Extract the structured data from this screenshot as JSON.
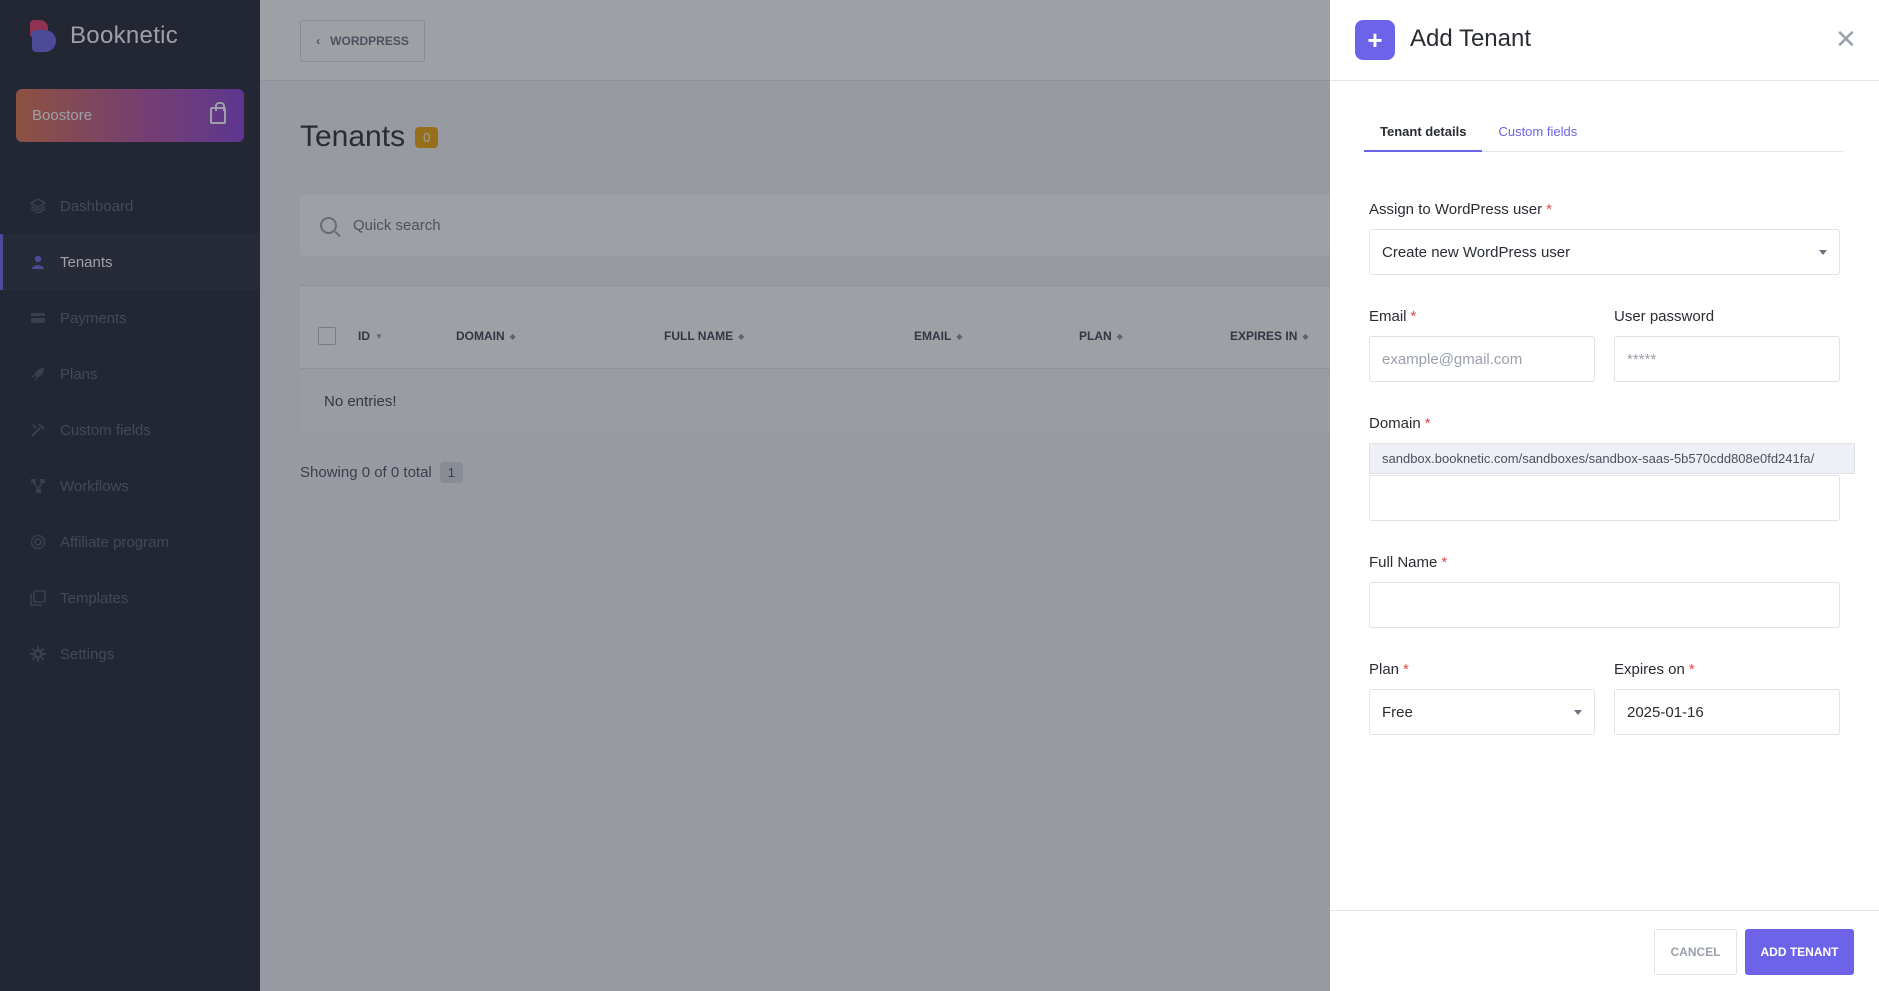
{
  "app": {
    "name": "Booknetic"
  },
  "boostore": {
    "label": "Boostore"
  },
  "sidebar": {
    "items": [
      {
        "label": "Dashboard",
        "icon": "dashboard-icon"
      },
      {
        "label": "Tenants",
        "icon": "user-icon",
        "active": true
      },
      {
        "label": "Payments",
        "icon": "card-icon"
      },
      {
        "label": "Plans",
        "icon": "rocket-icon"
      },
      {
        "label": "Custom fields",
        "icon": "tools-icon"
      },
      {
        "label": "Workflows",
        "icon": "workflow-icon"
      },
      {
        "label": "Affiliate program",
        "icon": "target-icon"
      },
      {
        "label": "Templates",
        "icon": "templates-icon"
      },
      {
        "label": "Settings",
        "icon": "gear-icon"
      }
    ]
  },
  "topbar": {
    "back_label": "WORDPRESS"
  },
  "page": {
    "title": "Tenants",
    "count": "0",
    "search_placeholder": "Quick search",
    "columns": [
      "ID",
      "DOMAIN",
      "FULL NAME",
      "EMAIL",
      "PLAN",
      "EXPIRES IN"
    ],
    "empty_text": "No entries!",
    "showing_text": "Showing 0 of 0 total",
    "page_number": "1"
  },
  "drawer": {
    "title": "Add Tenant",
    "tabs": [
      "Tenant details",
      "Custom fields"
    ],
    "fields": {
      "wp_user": {
        "label": "Assign to WordPress user",
        "value": "Create new WordPress user"
      },
      "email": {
        "label": "Email",
        "placeholder": "example@gmail.com"
      },
      "password": {
        "label": "User password",
        "placeholder": "*****"
      },
      "domain": {
        "label": "Domain",
        "prefix": "sandbox.booknetic.com/sandboxes/sandbox-saas-5b570cdd808e0fd241fa/",
        "value": ""
      },
      "full_name": {
        "label": "Full Name",
        "value": ""
      },
      "plan": {
        "label": "Plan",
        "value": "Free"
      },
      "expires": {
        "label": "Expires on",
        "value": "2025-01-16"
      }
    },
    "cancel_label": "CANCEL",
    "submit_label": "ADD TENANT"
  },
  "colors": {
    "accent": "#6c63e8",
    "sidebar": "#1f2230",
    "badge": "#f2a500",
    "required": "#e84545"
  }
}
